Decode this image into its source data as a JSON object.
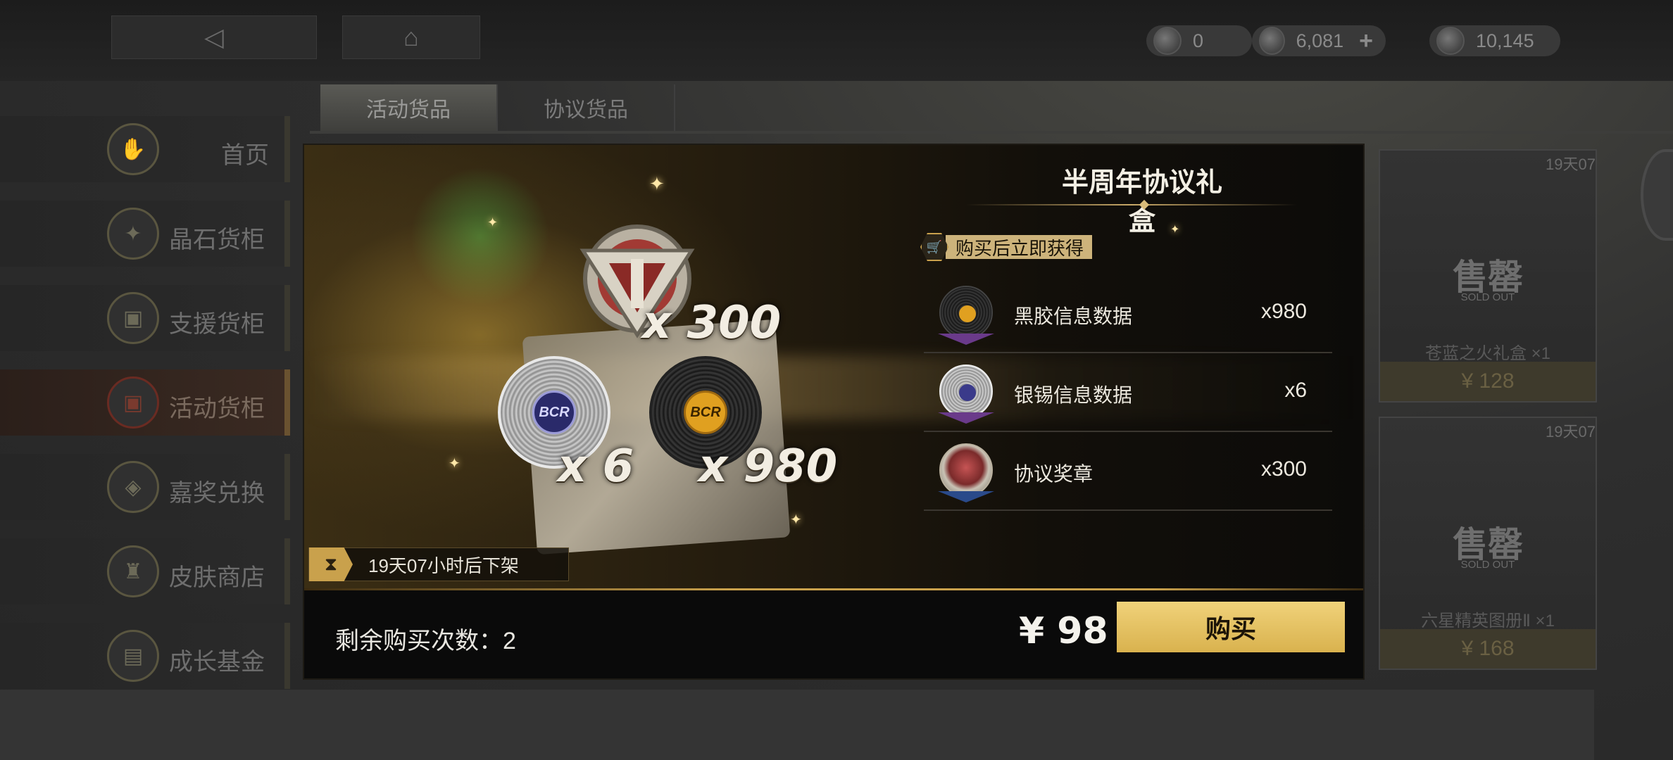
{
  "currencies": [
    {
      "icon": "ticket-currency-icon",
      "value": "0"
    },
    {
      "icon": "crystal-currency-icon",
      "value": "6,081",
      "plus": "+"
    },
    {
      "icon": "globe-currency-icon",
      "value": "10,145"
    }
  ],
  "tabs": [
    {
      "label": "活动货品",
      "active": true
    },
    {
      "label": "协议货品",
      "active": false
    }
  ],
  "sidebar": {
    "items": [
      {
        "label": "首页",
        "icon": "hand-icon"
      },
      {
        "label": "晶石货柜",
        "icon": "crystal-icon"
      },
      {
        "label": "支援货柜",
        "icon": "crate-icon"
      },
      {
        "label": "活动货柜",
        "icon": "event-crate-icon",
        "active": true
      },
      {
        "label": "嘉奖兑换",
        "icon": "medal-icon"
      },
      {
        "label": "皮肤商店",
        "icon": "jacket-icon"
      },
      {
        "label": "成长基金",
        "icon": "fund-icon"
      }
    ]
  },
  "bg_cards": [
    {
      "timer": "19天07",
      "sold": "售罄",
      "sold_en": "SOLD OUT",
      "name": "苍蓝之火礼盒 ×1",
      "price": "¥ 128"
    },
    {
      "timer": "19天07",
      "sold": "售罄",
      "sold_en": "SOLD OUT",
      "name": "六星精英图册Ⅱ ×1",
      "price": "¥ 168"
    }
  ],
  "modal": {
    "title": "半周年协议礼盒",
    "obtain_label": "购买后立即获得",
    "art_quantities": {
      "medal": "x 300",
      "silver": "x 6",
      "black": "x 980"
    },
    "disc_label": "BCR",
    "timer": "19天07小时后下架",
    "rewards": [
      {
        "name": "黑胶信息数据",
        "qty": "x980",
        "icon": "black-vinyl-icon"
      },
      {
        "name": "银锡信息数据",
        "qty": "x6",
        "icon": "silver-disc-icon"
      },
      {
        "name": "协议奖章",
        "qty": "x300",
        "icon": "protocol-medal-icon"
      }
    ],
    "remaining": "剩余购买次数：2",
    "price": "¥ 98",
    "buy_label": "购买"
  },
  "colors": {
    "gold": "#c9a14c",
    "buy_button": "#e3c263",
    "active_sidebar": "#6a2b22"
  }
}
